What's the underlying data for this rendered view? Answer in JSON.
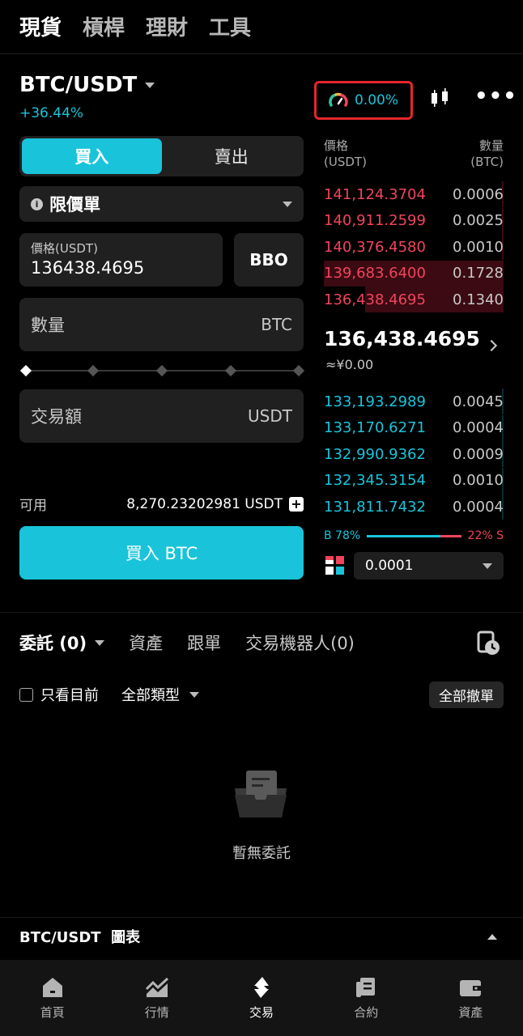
{
  "top_tabs": [
    {
      "label": "現貨",
      "active": true
    },
    {
      "label": "槓桿",
      "active": false
    },
    {
      "label": "理財",
      "active": false
    },
    {
      "label": "工具",
      "active": false
    }
  ],
  "pair": {
    "name": "BTC/USDT",
    "change": "+36.44%"
  },
  "performance": {
    "value": "0.00%",
    "icon": "gauge-icon"
  },
  "trade_form": {
    "buy_label": "買入",
    "sell_label": "賣出",
    "active_side": "buy",
    "order_type": "限價單",
    "price_label": "價格(USDT)",
    "price_value": "136438.4695",
    "bbo_label": "BBO",
    "amount_label": "數量",
    "amount_unit": "BTC",
    "total_label": "交易額",
    "total_unit": "USDT",
    "slider_percent": 0,
    "available_label": "可用",
    "available_value": "8,270.23202981 USDT",
    "submit_label": "買入 BTC"
  },
  "order_book": {
    "price_header": "價格\n(USDT)",
    "qty_header": "數量\n(BTC)",
    "asks": [
      {
        "price": "141,124.3704",
        "qty": "0.0006",
        "depth": 0.01
      },
      {
        "price": "140,911.2599",
        "qty": "0.0025",
        "depth": 0.01
      },
      {
        "price": "140,376.4580",
        "qty": "0.0010",
        "depth": 0.01
      },
      {
        "price": "139,683.6400",
        "qty": "0.1728",
        "depth": 1.0
      },
      {
        "price": "136,438.4695",
        "qty": "0.1340",
        "depth": 0.77
      }
    ],
    "last_price": "136,438.4695",
    "last_fiat": "≈¥0.00",
    "bids": [
      {
        "price": "133,193.2989",
        "qty": "0.0045",
        "depth": 0.01
      },
      {
        "price": "133,170.6271",
        "qty": "0.0004",
        "depth": 0.01
      },
      {
        "price": "132,990.9362",
        "qty": "0.0009",
        "depth": 0.01
      },
      {
        "price": "132,345.3154",
        "qty": "0.0010",
        "depth": 0.01
      },
      {
        "price": "131,811.7432",
        "qty": "0.0004",
        "depth": 0.01
      }
    ],
    "buy_ratio_label": "B 78%",
    "sell_ratio_label": "22% S",
    "buy_ratio": 0.78,
    "precision": "0.0001"
  },
  "orders": {
    "tabs": [
      "委託 (0)",
      "資產",
      "跟單",
      "交易機器人(0)"
    ],
    "only_current_label": "只看目前",
    "type_filter": "全部類型",
    "cancel_all_label": "全部撤單",
    "empty_text": "暫無委託"
  },
  "chart_section": {
    "label": "BTC/USDT  圖表"
  },
  "bottom_nav": [
    {
      "label": "首頁",
      "icon": "home-icon",
      "active": false
    },
    {
      "label": "行情",
      "icon": "market-icon",
      "active": false
    },
    {
      "label": "交易",
      "icon": "trade-icon",
      "active": true
    },
    {
      "label": "合約",
      "icon": "futures-icon",
      "active": false
    },
    {
      "label": "資產",
      "icon": "wallet-icon",
      "active": false
    }
  ],
  "colors": {
    "accent": "#19c4da",
    "ask": "#f0445c",
    "background": "#000000",
    "highlight_box": "#e5262b"
  }
}
